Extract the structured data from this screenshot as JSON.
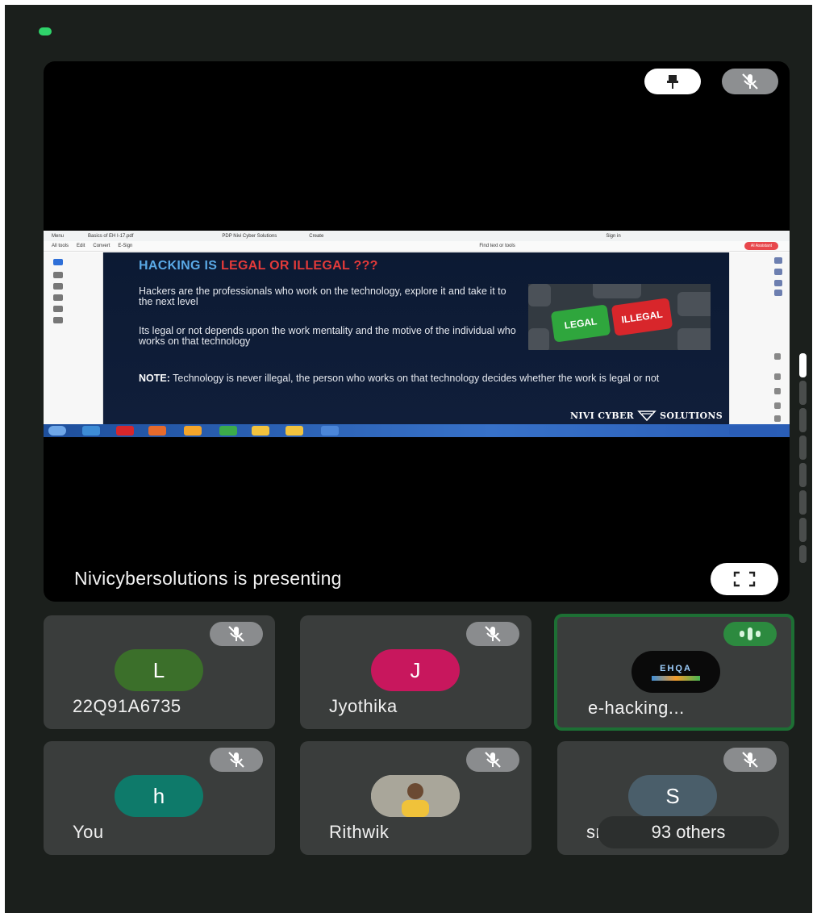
{
  "stage": {
    "presenting_text": "Nivicybersolutions is presenting",
    "pin_icon": "pin-icon",
    "mic_off_icon": "mic-off-icon",
    "fullscreen_icon": "fullscreen-icon"
  },
  "shared_window": {
    "tabs": [
      "Menu",
      "Basics of EH I-17.pdf",
      "PDP Nivi Cyber Solutions",
      "Create",
      "Sign in"
    ],
    "toolbar": [
      "All tools",
      "Edit",
      "Convert",
      "E-Sign",
      "Find text or tools"
    ],
    "ai_label": "AI Assistant",
    "slide": {
      "title_part1": "HACKING IS ",
      "title_part2": "LEGAL OR ILLEGAL ???",
      "para1": "Hackers are the professionals who work on the technology, explore it and take it to the next level",
      "para2": "Its legal or not depends upon the work mentality and the motive of the individual who works on that technology",
      "note_label": "NOTE:",
      "note_text": " Technology is never illegal, the person who works on that technology decides whether the work is legal or not",
      "image_key_legal": "LEGAL",
      "image_key_illegal": "ILLEGAL",
      "brand_left": "NIVI CYBER",
      "brand_right": "SOLUTIONS"
    }
  },
  "participants": [
    {
      "name": "22Q91A6735",
      "initial": "L",
      "avatar_color": "#3b6f2a",
      "state": "muted"
    },
    {
      "name": "Jyothika",
      "initial": "J",
      "avatar_color": "#c8175d",
      "state": "muted"
    },
    {
      "name": "e-hacking...",
      "initial": "",
      "logo_text": "EHQA",
      "state": "speaking"
    },
    {
      "name": "You",
      "initial": "h",
      "avatar_color": "#0e7a6a",
      "state": "muted"
    },
    {
      "name": "Rithwik",
      "initial": "",
      "state": "muted"
    },
    {
      "name": "sra",
      "initial": "S",
      "avatar_color": "#4a5e6a",
      "state": "muted",
      "others_label": "93 others"
    }
  ]
}
